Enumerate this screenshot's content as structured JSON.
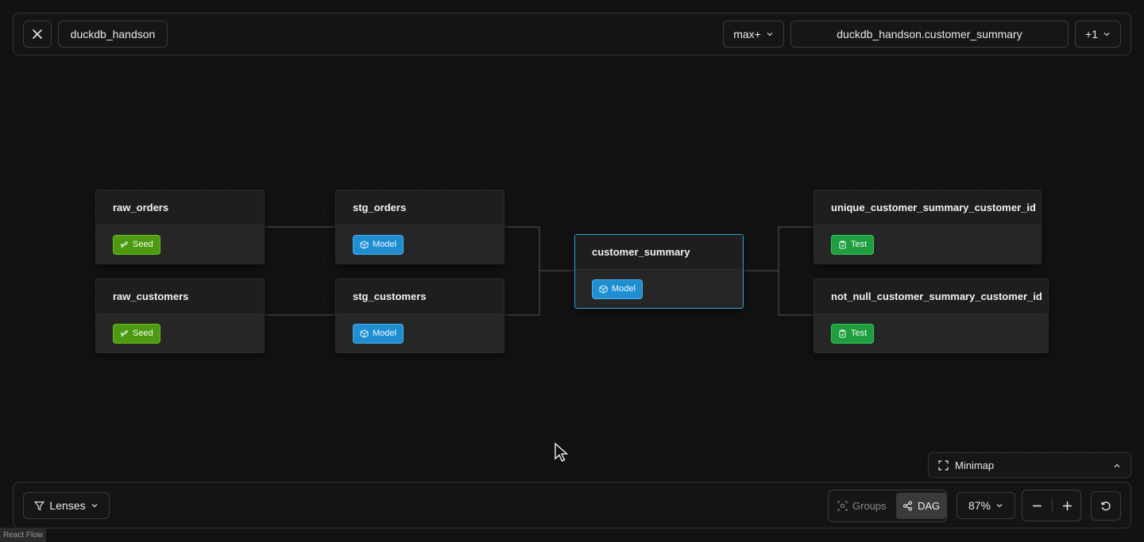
{
  "header": {
    "project": "duckdb_handson",
    "depth_selector": "max+",
    "selected_model": "duckdb_handson.customer_summary",
    "extra_selection": "+1"
  },
  "nodes": {
    "raw_orders": {
      "name": "raw_orders",
      "type": "Seed"
    },
    "raw_customers": {
      "name": "raw_customers",
      "type": "Seed"
    },
    "stg_orders": {
      "name": "stg_orders",
      "type": "Model"
    },
    "stg_customers": {
      "name": "stg_customers",
      "type": "Model"
    },
    "customer_summary": {
      "name": "customer_summary",
      "type": "Model"
    },
    "unique_test": {
      "name": "unique_customer_summary_customer_id",
      "type": "Test"
    },
    "not_null_test": {
      "name": "not_null_customer_summary_customer_id",
      "type": "Test"
    }
  },
  "minimap": {
    "label": "Minimap"
  },
  "footer": {
    "lenses": "Lenses",
    "groups": "Groups",
    "dag": "DAG",
    "zoom": "87%"
  },
  "attribution": "React Flow",
  "colors": {
    "seed": "#4d9a12",
    "model": "#1e8ed0",
    "test": "#1f9d3f",
    "selected_border": "#2ea1e6"
  }
}
